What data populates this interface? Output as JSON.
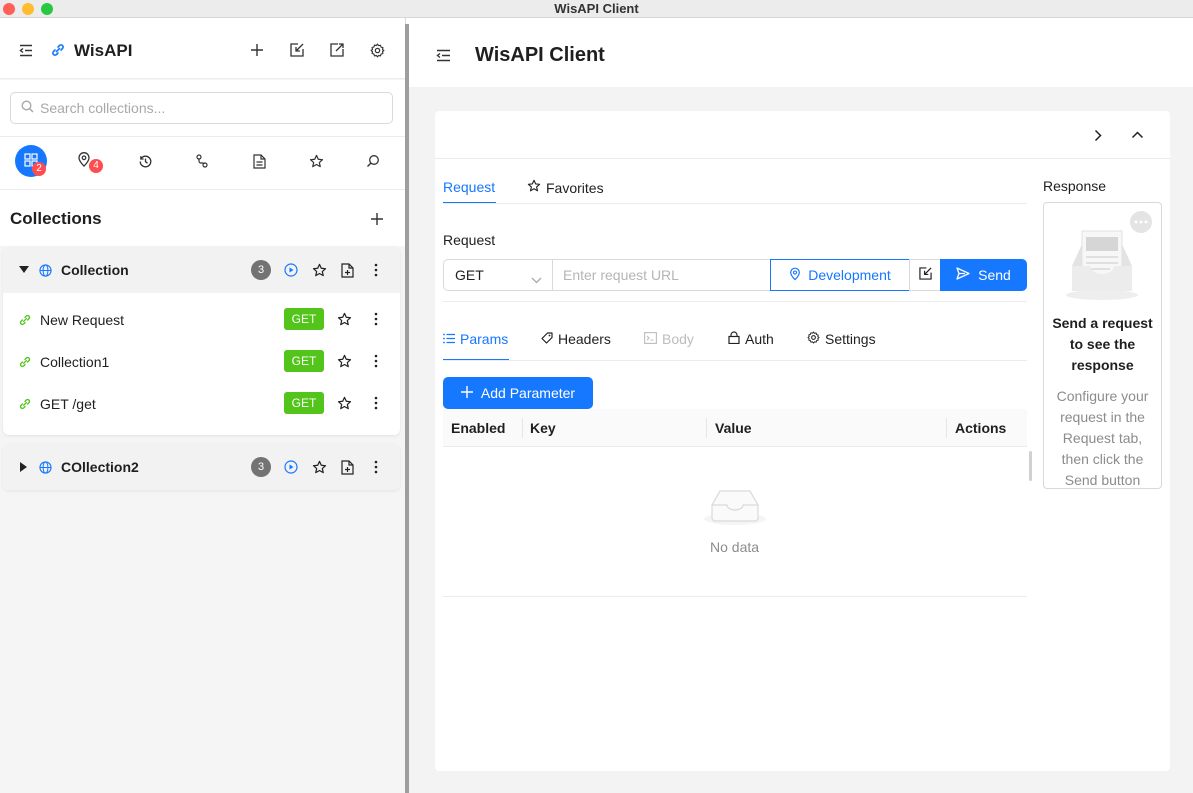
{
  "window": {
    "title": "WisAPI Client"
  },
  "sidebar": {
    "app_name": "WisAPI",
    "search": {
      "placeholder": "Search collections..."
    },
    "nav_badges": {
      "collections": "2",
      "environments": "4"
    },
    "collections_title": "Collections",
    "groups": [
      {
        "name": "Collection",
        "count": "3",
        "expanded": true,
        "requests": [
          {
            "name": "New Request",
            "method": "GET"
          },
          {
            "name": "Collection1",
            "method": "GET"
          },
          {
            "name": "GET /get",
            "method": "GET"
          }
        ]
      },
      {
        "name": "COllection2",
        "count": "3",
        "expanded": false
      }
    ]
  },
  "main": {
    "title": "WisAPI Client",
    "tabs": {
      "request": "Request",
      "favorites": "Favorites"
    },
    "request_label": "Request",
    "method": "GET",
    "url_placeholder": "Enter request URL",
    "environment": "Development",
    "send_label": "Send",
    "sub_tabs": {
      "params": "Params",
      "headers": "Headers",
      "body": "Body",
      "auth": "Auth",
      "settings": "Settings"
    },
    "add_parameter": "Add Parameter",
    "table": {
      "columns": {
        "enabled": "Enabled",
        "key": "Key",
        "value": "Value",
        "actions": "Actions"
      },
      "empty": "No data"
    },
    "response": {
      "label": "Response",
      "title": "Send a request to see the response",
      "description": "Configure your request in the Request tab, then click the Send button"
    }
  },
  "colors": {
    "accent": "#1677ff",
    "get_method": "#52c41a",
    "badge": "#ff4d4f"
  }
}
